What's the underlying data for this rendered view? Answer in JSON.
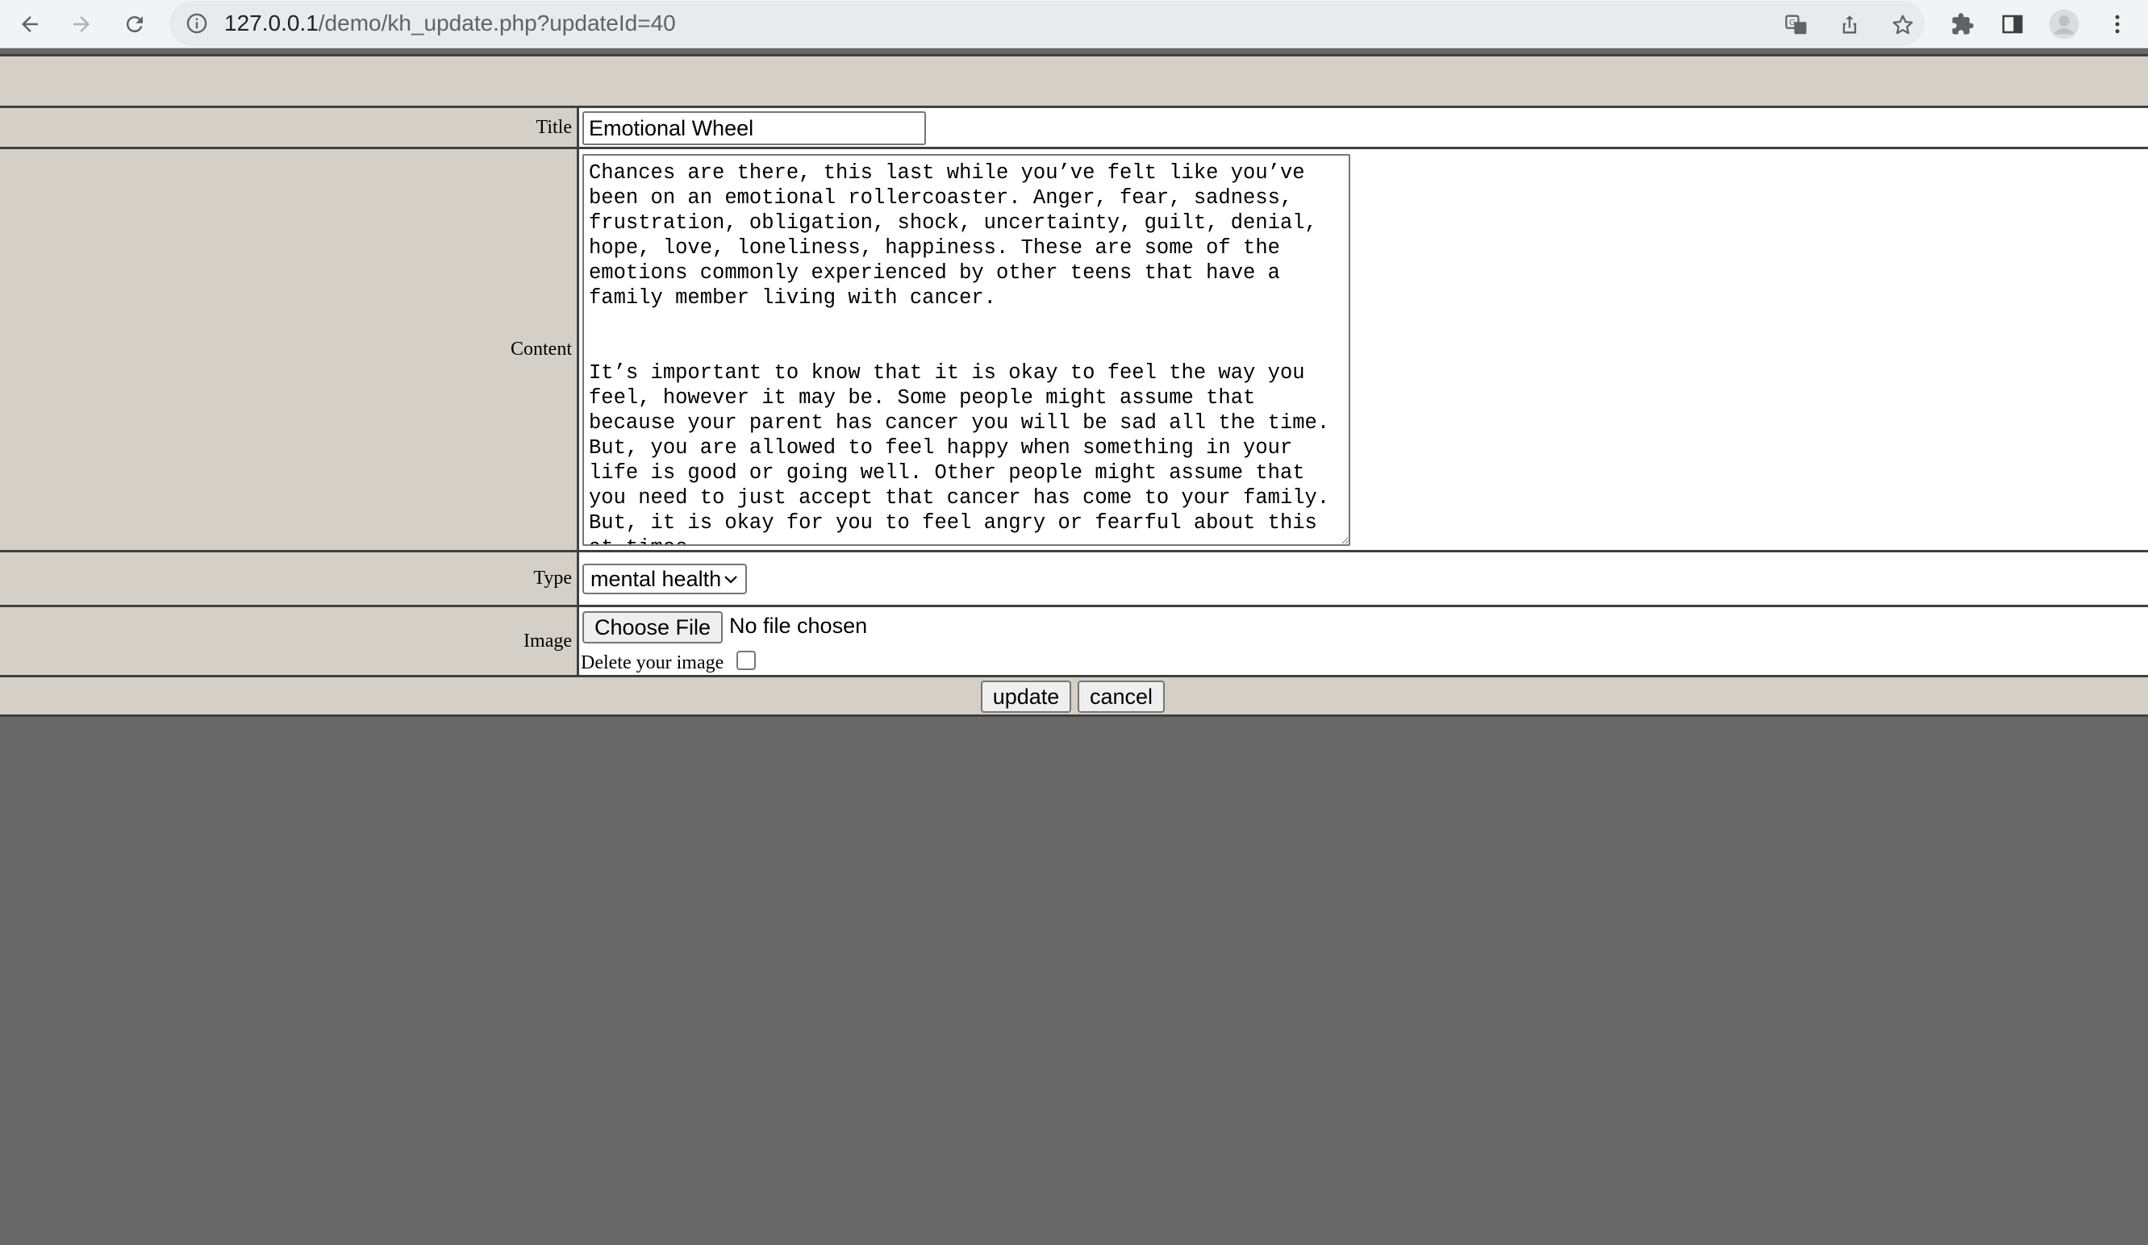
{
  "browser": {
    "url_host": "127.0.0.1",
    "url_path": "/demo/kh_update.php?updateId=40"
  },
  "form": {
    "title_label": "Title",
    "title_value": "Emotional Wheel",
    "content_label": "Content",
    "content_value": "Chances are there, this last while you’ve felt like you’ve been on an emotional rollercoaster. Anger, fear, sadness, frustration, obligation, shock, uncertainty, guilt, denial, hope, love, loneliness, happiness. These are some of the emotions commonly experienced by other teens that have a family member living with cancer.\n\n\nIt’s important to know that it is okay to feel the way you feel, however it may be. Some people might assume that because your parent has cancer you will be sad all the time. But, you are allowed to feel happy when something in your life is good or going well. Other people might assume that you need to just accept that cancer has come to your family. But, it is okay for you to feel angry or fearful about this at times.",
    "type_label": "Type",
    "type_value": "mental health",
    "image_label": "Image",
    "file_button": "Choose File",
    "file_status": "No file chosen",
    "delete_label": "Delete your image",
    "delete_checked": false,
    "update_button": "update",
    "cancel_button": "cancel"
  }
}
